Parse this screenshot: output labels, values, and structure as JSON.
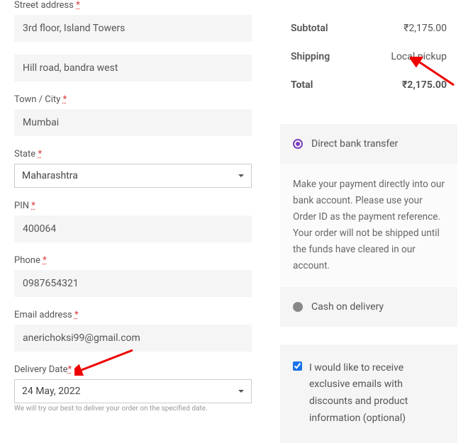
{
  "form": {
    "street_label": "Street address",
    "street_value": "3rd floor, Island Towers",
    "street2_value": "Hill road, bandra west",
    "city_label": "Town / City",
    "city_value": "Mumbai",
    "state_label": "State",
    "state_value": "Maharashtra",
    "pin_label": "PIN",
    "pin_value": "400064",
    "phone_label": "Phone",
    "phone_value": "0987654321",
    "email_label": "Email address",
    "email_value": "anerichoksi99@gmail.com",
    "delivery_label": "Delivery Date",
    "delivery_value": "24 May, 2022",
    "delivery_hint": "We will try our best to deliver your order on the specified date."
  },
  "summary": {
    "subtotal_label": "Subtotal",
    "subtotal_value": "₹2,175.00",
    "shipping_label": "Shipping",
    "shipping_value": "Local pickup",
    "total_label": "Total",
    "total_value": "₹2,175.00"
  },
  "payment": {
    "bank_label": "Direct bank transfer",
    "bank_desc": "Make your payment directly into our bank account. Please use your Order ID as the payment reference. Your order will not be shipped until the funds have cleared in our account.",
    "cod_label": "Cash on delivery"
  },
  "consent": {
    "text": "I would like to receive exclusive emails with discounts and product information (optional)"
  },
  "req_marker": "*"
}
